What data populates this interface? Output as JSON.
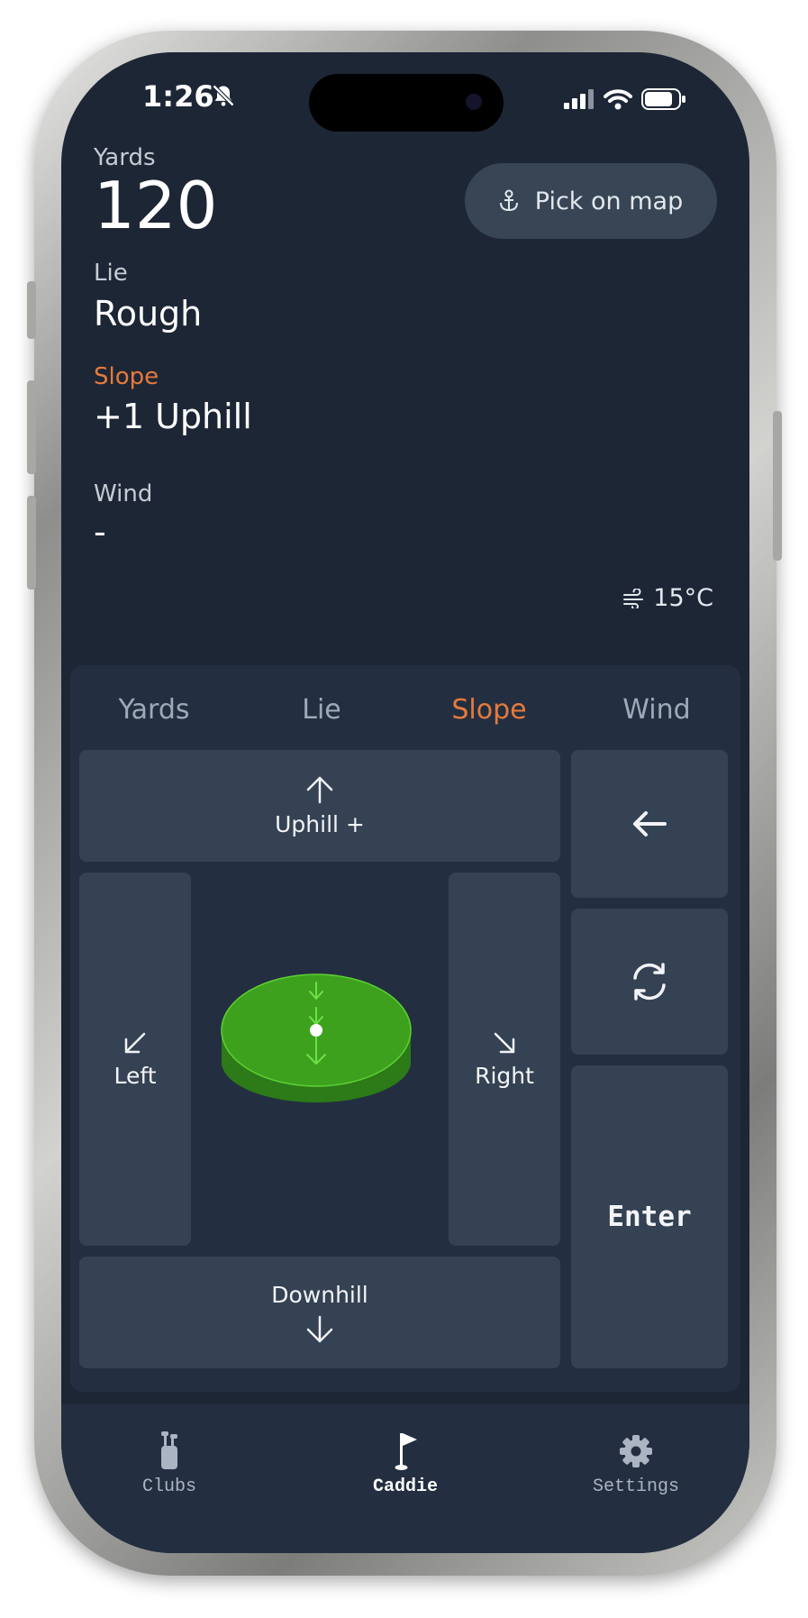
{
  "status_bar": {
    "time": "1:26"
  },
  "fields": {
    "yards": {
      "label": "Yards",
      "value": "120"
    },
    "lie": {
      "label": "Lie",
      "value": "Rough"
    },
    "slope": {
      "label": "Slope",
      "value": "+1 Uphill"
    },
    "wind": {
      "label": "Wind",
      "value": "-"
    }
  },
  "pick_on_map": {
    "label": "Pick on map",
    "icon": "anchor-icon"
  },
  "weather": {
    "temperature": "15°C",
    "icon": "wind-icon"
  },
  "tabs": [
    {
      "label": "Yards",
      "active": false
    },
    {
      "label": "Lie",
      "active": false
    },
    {
      "label": "Slope",
      "active": true
    },
    {
      "label": "Wind",
      "active": false
    }
  ],
  "keypad": {
    "uphill": "Uphill +",
    "downhill": "Downhill",
    "left": "Left",
    "right": "Right",
    "enter": "Enter",
    "backspace_icon": "arrow-left-icon",
    "reset_icon": "refresh-icon"
  },
  "nav": [
    {
      "label": "Clubs",
      "icon": "golf-bag-icon",
      "active": false
    },
    {
      "label": "Caddie",
      "icon": "flag-icon",
      "active": true
    },
    {
      "label": "Settings",
      "icon": "gear-icon",
      "active": false
    }
  ],
  "colors": {
    "background": "#1d2635",
    "panel": "#232f40",
    "key": "#344253",
    "accent": "#e57a3c",
    "green": "#3da11e"
  }
}
